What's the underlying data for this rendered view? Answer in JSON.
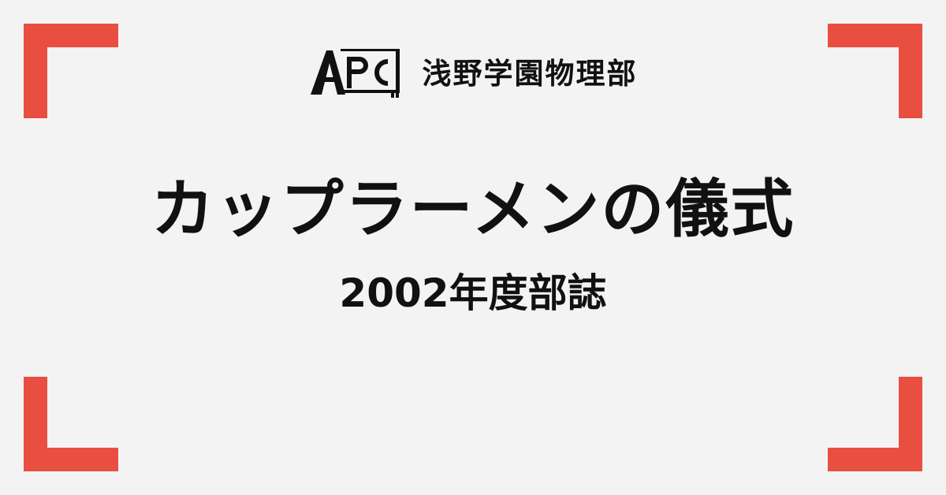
{
  "colors": {
    "background": "#f3f3f3",
    "accent": "#e94f40",
    "text": "#111111"
  },
  "header": {
    "logo_text": "APC",
    "club_name": "浅野学園物理部"
  },
  "main": {
    "title": "カップラーメンの儀式",
    "subtitle": "2002年度部誌"
  }
}
